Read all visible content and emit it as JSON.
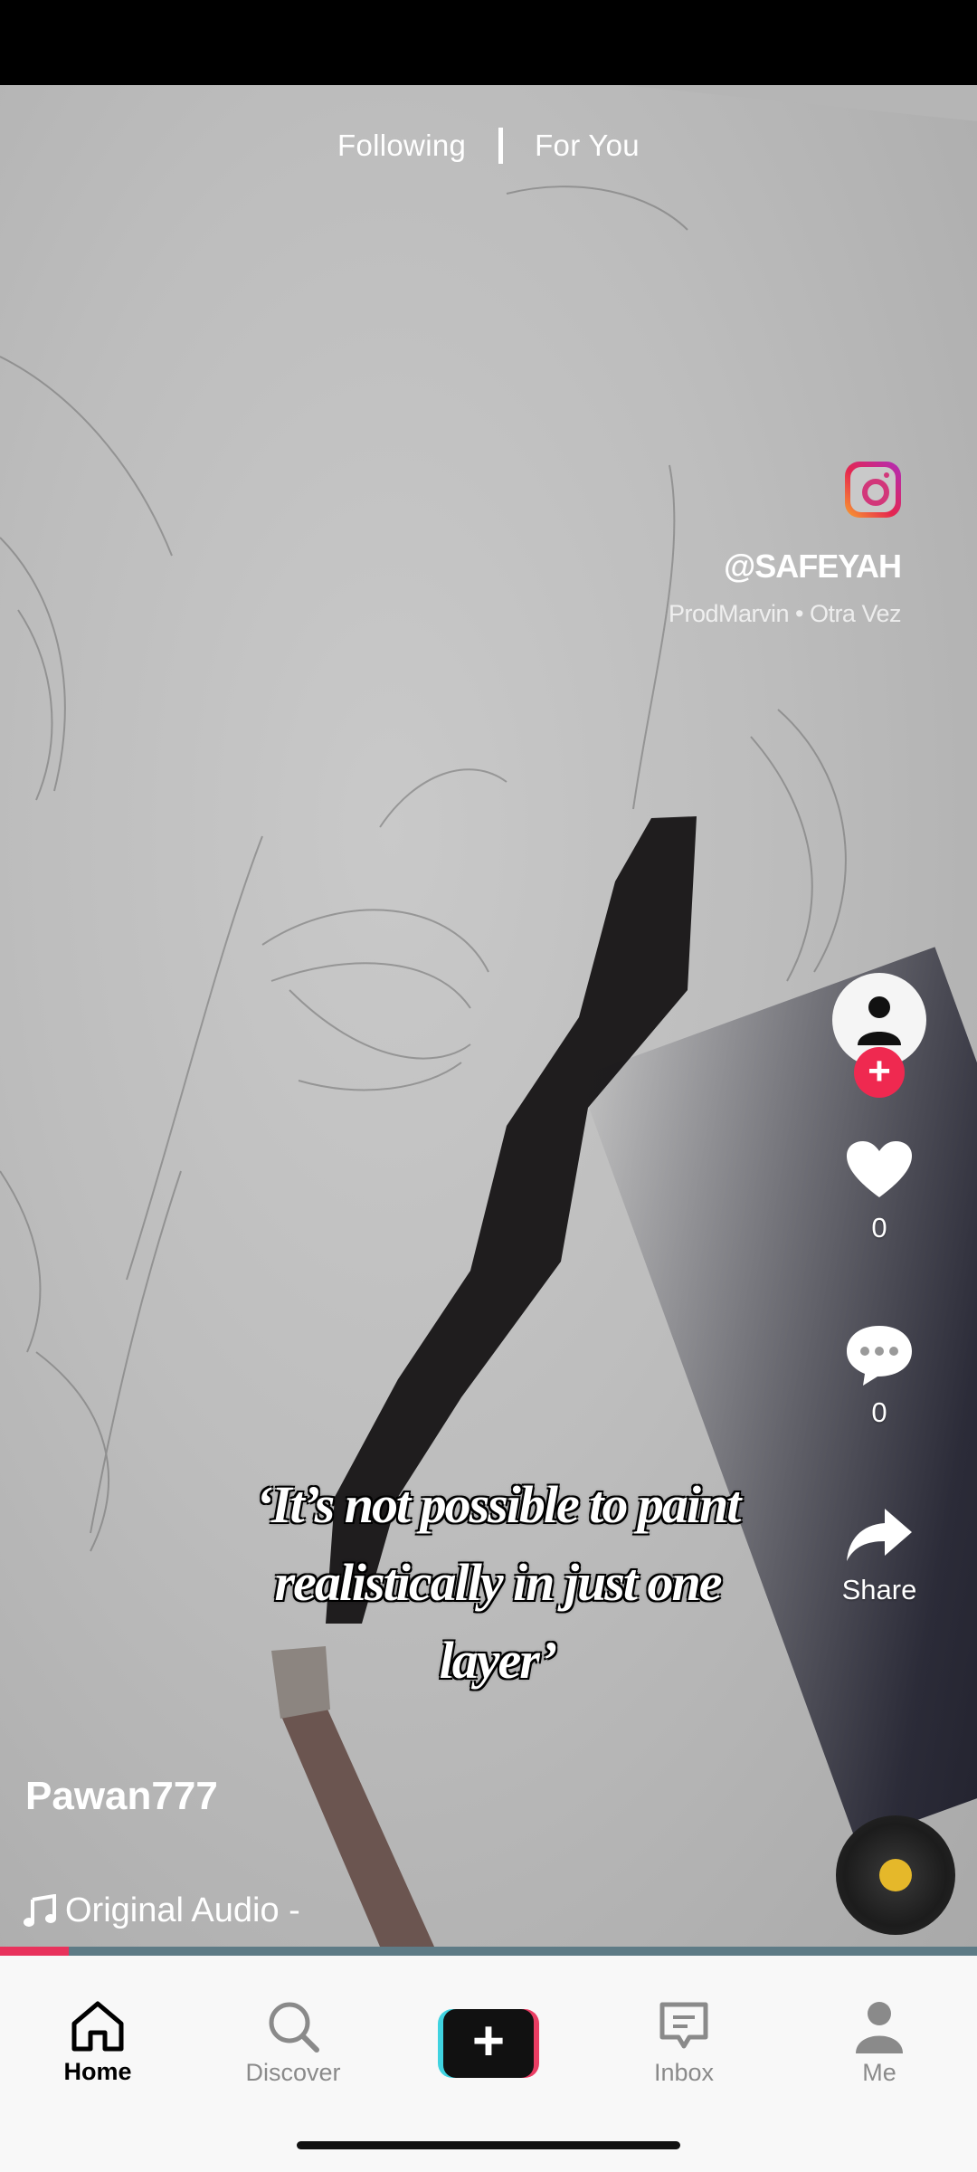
{
  "top_tabs": {
    "following": "Following",
    "for_you": "For You"
  },
  "watermark": {
    "handle": "@SAFEYAH",
    "credit": "ProdMarvin • Otra Vez"
  },
  "caption": {
    "line1": "‘It’s not possible to paint",
    "line2": "realistically in just one",
    "line3": "layer’"
  },
  "creator": {
    "username": "Pawan777"
  },
  "audio": {
    "title": "Original Audio -"
  },
  "actions": {
    "likes": "0",
    "comments": "0",
    "share_label": "Share"
  },
  "progress": {
    "fraction": 0.07
  },
  "nav": {
    "home": "Home",
    "discover": "Discover",
    "inbox": "Inbox",
    "me": "Me"
  },
  "colors": {
    "accent_red": "#ef2950",
    "progress_fill": "#e8325c",
    "progress_track": "#5e7b86",
    "create_cyan": "#40d3e0"
  },
  "icons": [
    "instagram-icon",
    "person-icon",
    "plus-icon",
    "heart-icon",
    "comment-icon",
    "share-icon",
    "music-note-icon",
    "home-icon",
    "search-icon",
    "inbox-icon",
    "profile-icon",
    "music-disc-icon"
  ]
}
